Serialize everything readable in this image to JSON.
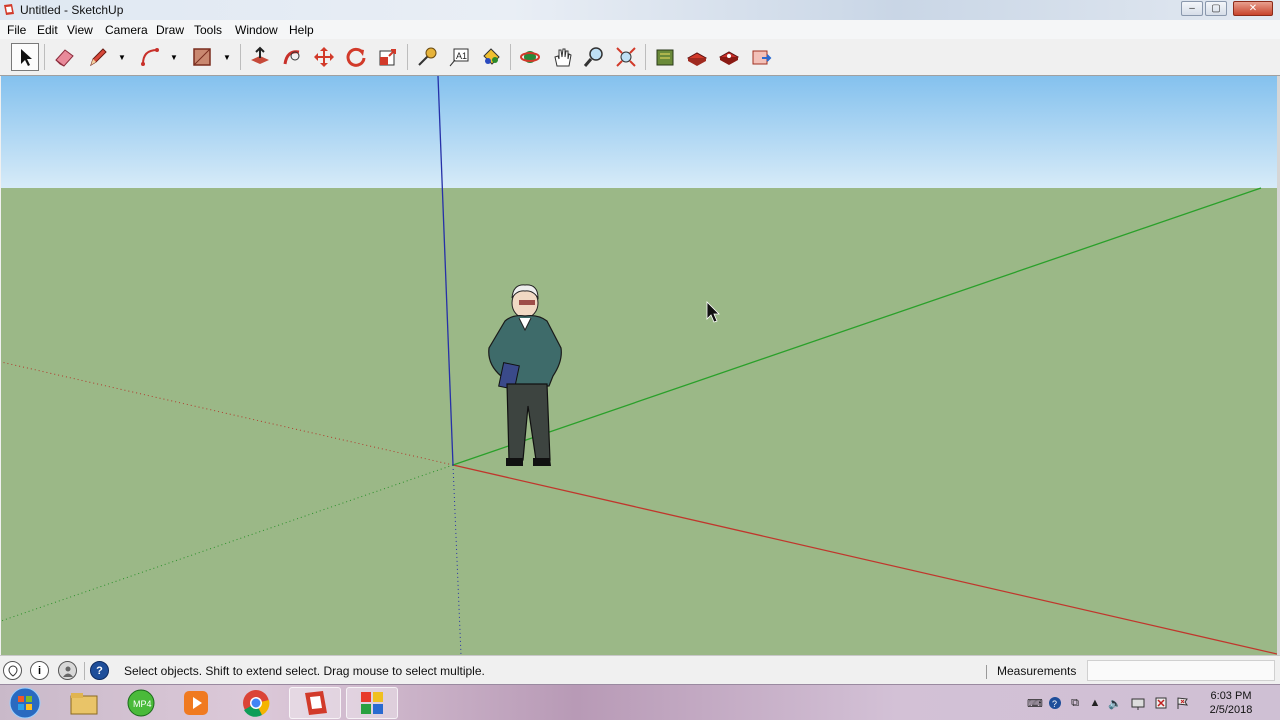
{
  "window": {
    "title": "Untitled - SketchUp",
    "controls": {
      "minimize": "‒",
      "maximize": "▢",
      "close": "✕"
    }
  },
  "menubar": {
    "items": [
      "File",
      "Edit",
      "View",
      "Camera",
      "Draw",
      "Tools",
      "Window",
      "Help"
    ]
  },
  "toolbar": {
    "tools": [
      {
        "name": "select-tool",
        "icon": "arrow-pointer-icon",
        "active": true
      },
      {
        "name": "eraser-tool",
        "icon": "eraser-icon"
      },
      {
        "name": "pencil-line-tool",
        "icon": "pencil-icon",
        "dropdown": true
      },
      {
        "name": "arc-tool",
        "icon": "arc-icon",
        "dropdown": true
      },
      {
        "name": "rectangle-tool",
        "icon": "rectangle-icon",
        "dropdown": true
      },
      {
        "name": "push-pull-tool",
        "icon": "push-pull-icon"
      },
      {
        "name": "follow-me-tool",
        "icon": "follow-me-icon"
      },
      {
        "name": "move-tool",
        "icon": "move-icon"
      },
      {
        "name": "rotate-tool",
        "icon": "rotate-icon"
      },
      {
        "name": "scale-tool",
        "icon": "scale-icon"
      },
      {
        "name": "tape-measure-tool",
        "icon": "tape-measure-icon"
      },
      {
        "name": "text-tool",
        "icon": "text-icon"
      },
      {
        "name": "paint-bucket-tool",
        "icon": "paint-bucket-icon"
      },
      {
        "name": "orbit-tool",
        "icon": "orbit-icon"
      },
      {
        "name": "pan-tool",
        "icon": "pan-hand-icon"
      },
      {
        "name": "zoom-tool",
        "icon": "zoom-icon"
      },
      {
        "name": "zoom-extents-tool",
        "icon": "zoom-extents-icon"
      },
      {
        "name": "3d-warehouse-tool",
        "icon": "warehouse-icon"
      },
      {
        "name": "extension-warehouse-tool",
        "icon": "extension-icon"
      },
      {
        "name": "share-model-tool",
        "icon": "share-model-icon"
      },
      {
        "name": "send-to-layout-tool",
        "icon": "layout-icon"
      }
    ]
  },
  "viewport": {
    "sky_color": "#a9d3f0",
    "ground_color": "#9bb887",
    "axis_colors": {
      "red": "#c0362c",
      "green": "#2aa02a",
      "blue": "#2630a8"
    },
    "scale_figure": "person-figure"
  },
  "statusbar": {
    "icons": [
      "geolocation-icon",
      "credits-icon",
      "user-icon",
      "help-icon"
    ],
    "message": "Select objects. Shift to extend select. Drag mouse to select multiple.",
    "measurements_label": "Measurements",
    "measurements_value": ""
  },
  "taskbar": {
    "apps": [
      "start-button",
      "file-explorer-icon",
      "mp4-converter-icon",
      "media-player-icon",
      "chrome-icon",
      "sketchup-icon",
      "app-grid-icon"
    ],
    "clock_time": "6:03 PM",
    "clock_date": "2/5/2018"
  }
}
